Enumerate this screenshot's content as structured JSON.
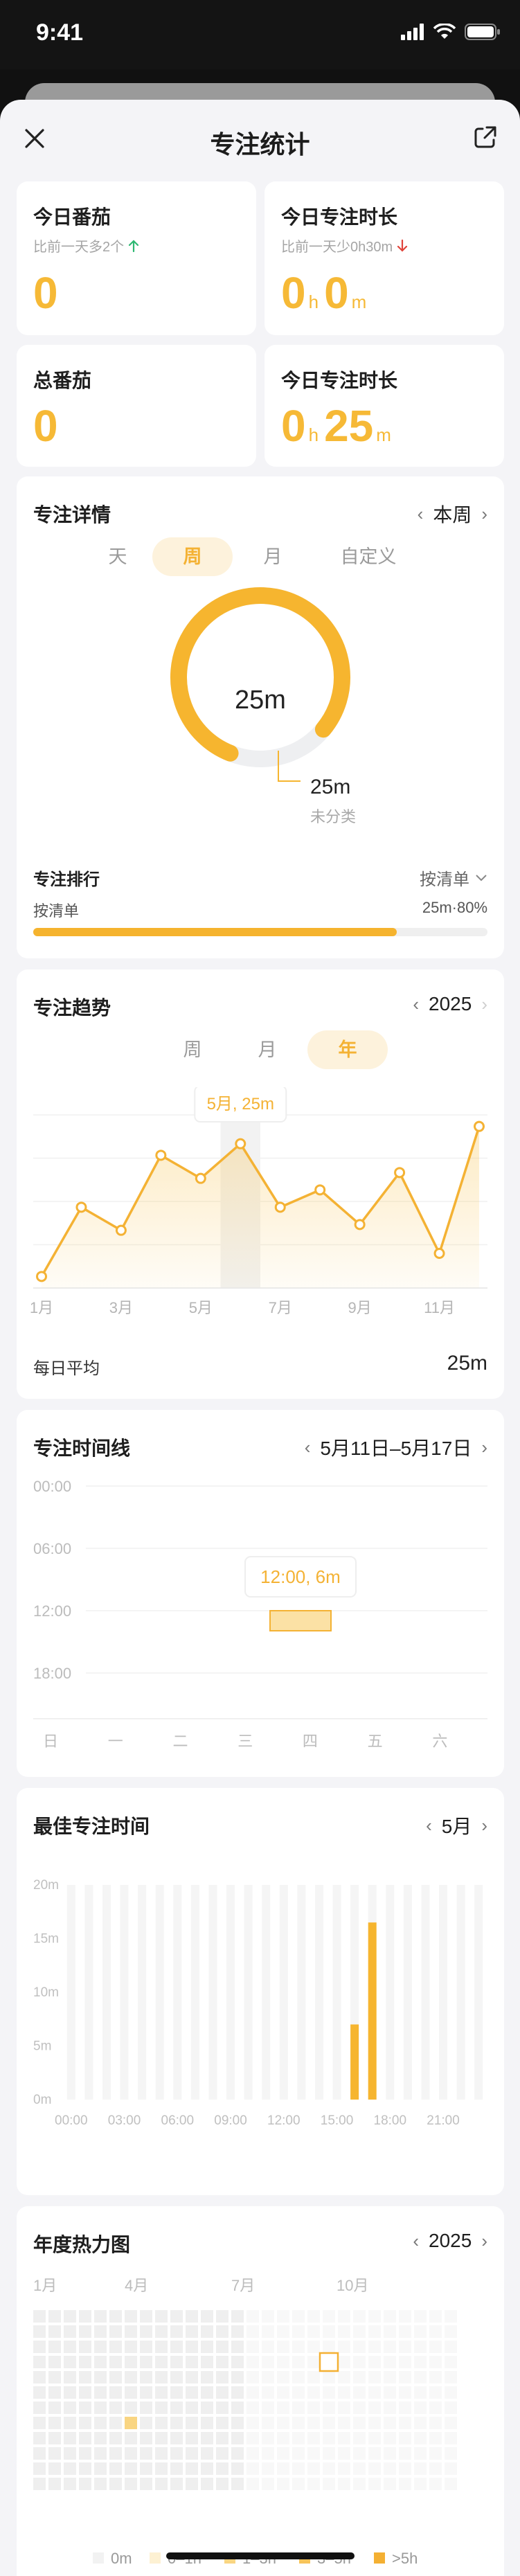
{
  "status_bar": {
    "time": "9:41"
  },
  "nav": {
    "title": "专注统计"
  },
  "today_pomodoro": {
    "title": "今日番茄",
    "compare": "比前一天多2个",
    "value": "0"
  },
  "today_focus": {
    "title": "今日专注时长",
    "compare": "比前一天少0h30m",
    "hours": "0",
    "minutes": "0",
    "hour_unit": "h",
    "minute_unit": "m"
  },
  "total_pomodoro": {
    "title": "总番茄",
    "value": "0"
  },
  "total_focus": {
    "title": "今日专注时长",
    "hours": "0",
    "minutes": "25",
    "hour_unit": "h",
    "minute_unit": "m"
  },
  "focus_detail": {
    "title": "专注详情",
    "period": "本周",
    "tabs": [
      "天",
      "周",
      "月",
      "自定义"
    ],
    "active_tab": 1,
    "ring_center": "25m",
    "ring_fraction": 0.8,
    "callout_value": "25m",
    "callout_label": "未分类",
    "ranking_title": "专注排行",
    "ranking_sort": "按清单",
    "ranking_item": "按清单",
    "ranking_value": "25m·80%",
    "ranking_fraction": 0.8
  },
  "focus_trend": {
    "title": "专注趋势",
    "year": "2025",
    "tabs": [
      "周",
      "月",
      "年"
    ],
    "active_tab": 2,
    "tooltip": "5月, 25m",
    "daily_avg_label": "每日平均",
    "daily_avg_value": "25m"
  },
  "timeline": {
    "title": "专注时间线",
    "range": "5月11日–5月17日",
    "times": [
      "00:00",
      "06:00",
      "12:00",
      "18:00"
    ],
    "days": [
      "日",
      "一",
      "二",
      "三",
      "四",
      "五",
      "六"
    ],
    "tooltip": "12:00, 6m",
    "block": {
      "day_index": 3.5,
      "start_hour": 12.0,
      "end_hour": 12.6
    }
  },
  "best_time": {
    "title": "最佳专注时间",
    "month": "5月",
    "y_labels": [
      "20m",
      "15m",
      "10m",
      "5m",
      "0m"
    ],
    "x_labels": [
      "00:00",
      "03:00",
      "06:00",
      "09:00",
      "12:00",
      "15:00",
      "18:00",
      "21:00"
    ],
    "bars": [
      {
        "slot": 16,
        "value": 7
      },
      {
        "slot": 17,
        "value": 16.5
      }
    ],
    "slots": 24,
    "ymax": 20
  },
  "heatmap": {
    "title": "年度热力图",
    "year": "2025",
    "months": [
      "1月",
      "4月",
      "7月",
      "10月"
    ],
    "legend": [
      "0m",
      "0–1h",
      "1–3h",
      "3–5h",
      ">5h"
    ],
    "legend_colors": [
      "#f2f2f2",
      "#fdf1d3",
      "#f9d582",
      "#f7c45a",
      "#f4b033"
    ],
    "colors": {
      "empty": "#efefef",
      "future": "#f8f8f8",
      "level3": "#f9d582",
      "today_border": "#f4b033"
    },
    "weeks": 21,
    "rows": 12,
    "filled_cells": [
      {
        "col": 6,
        "row": 7,
        "level": 3
      }
    ],
    "today_cell": {
      "col": 19,
      "row": 3
    }
  },
  "chart_data": [
    {
      "type": "area",
      "x": [
        "1月",
        "2月",
        "3月",
        "4月",
        "5月",
        "6月",
        "7月",
        "8月",
        "9月",
        "10月",
        "11月",
        "12月"
      ],
      "series": [
        {
          "values": [
            2,
            14,
            10,
            23,
            19,
            25,
            14,
            17,
            11,
            20,
            6,
            28
          ]
        }
      ],
      "tick_labels": [
        "1月",
        "3月",
        "5月",
        "7月",
        "9月",
        "11月"
      ],
      "ylim": [
        0,
        30
      ],
      "highlight": "5月, 25m"
    },
    {
      "type": "bar",
      "categories": [
        "00:00",
        "03:00",
        "06:00",
        "09:00",
        "12:00",
        "15:00",
        "18:00",
        "21:00"
      ],
      "series": [
        {
          "values": [
            7,
            16.5
          ]
        }
      ],
      "ylim": [
        0,
        20
      ]
    }
  ]
}
